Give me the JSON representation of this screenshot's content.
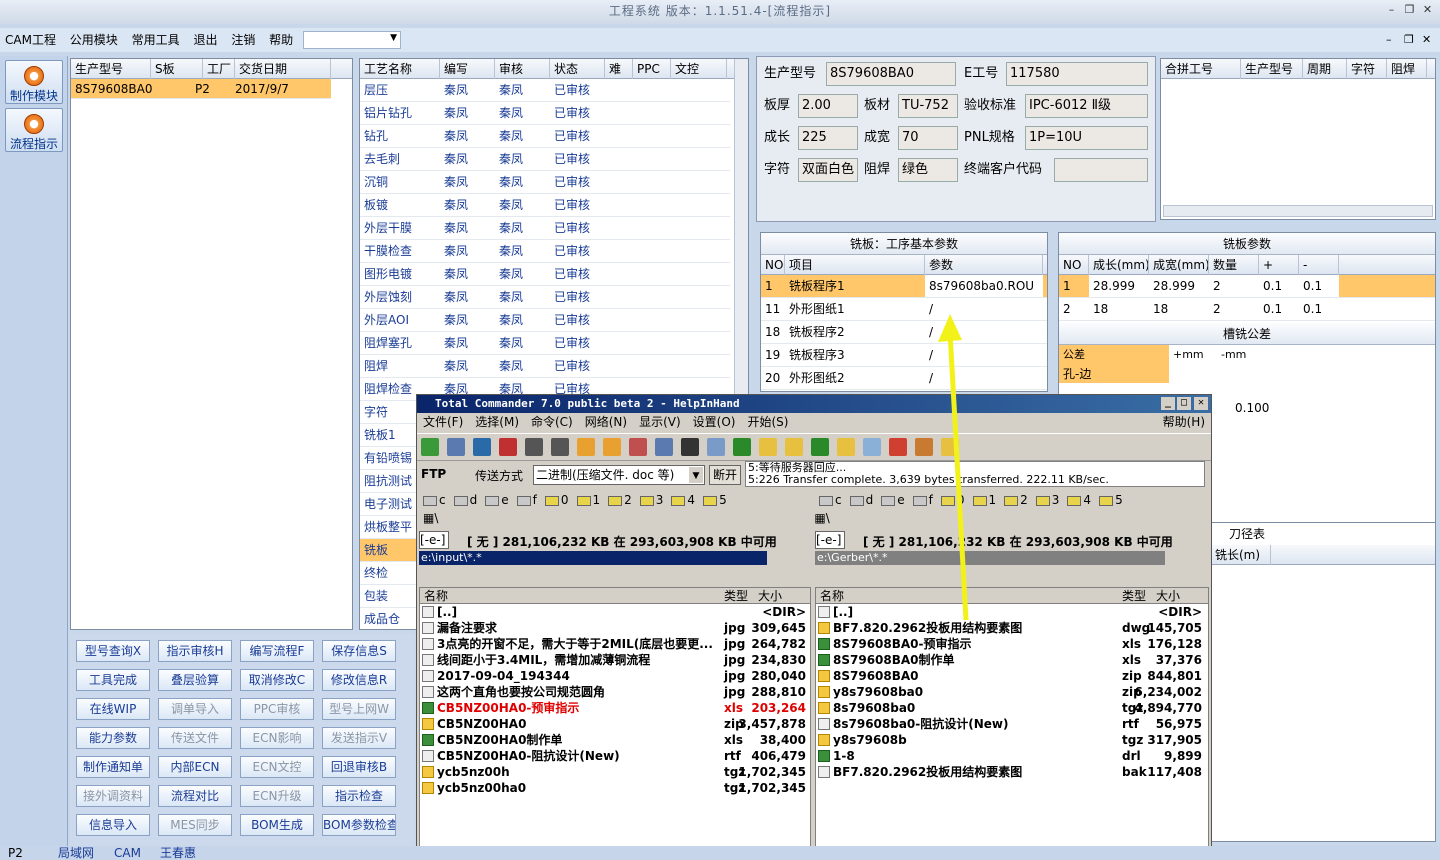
{
  "app": {
    "title": "工程系统 版本：1.1.51.4-[流程指示]"
  },
  "menu": [
    "CAM工程",
    "公用模块",
    "常用工具",
    "退出",
    "注销",
    "帮助"
  ],
  "left_buttons": [
    {
      "label": "制作模块"
    },
    {
      "label": "流程指示"
    }
  ],
  "job_grid": {
    "headers": [
      "生产型号",
      "S板",
      "工厂",
      "交货日期"
    ],
    "rows": [
      [
        "8S79608BA0",
        "",
        "P2",
        "2017/9/7"
      ]
    ]
  },
  "process_grid": {
    "headers": [
      "工艺名称",
      "编写",
      "审核",
      "状态",
      "难",
      "PPC",
      "文控"
    ],
    "rows": [
      [
        "层压",
        "秦凤",
        "秦凤",
        "已审核"
      ],
      [
        "铝片钻孔",
        "秦凤",
        "秦凤",
        "已审核"
      ],
      [
        "钻孔",
        "秦凤",
        "秦凤",
        "已审核"
      ],
      [
        "去毛刺",
        "秦凤",
        "秦凤",
        "已审核"
      ],
      [
        "沉铜",
        "秦凤",
        "秦凤",
        "已审核"
      ],
      [
        "板镀",
        "秦凤",
        "秦凤",
        "已审核"
      ],
      [
        "外层干膜",
        "秦凤",
        "秦凤",
        "已审核"
      ],
      [
        "干膜检查",
        "秦凤",
        "秦凤",
        "已审核"
      ],
      [
        "图形电镀",
        "秦凤",
        "秦凤",
        "已审核"
      ],
      [
        "外层蚀刻",
        "秦凤",
        "秦凤",
        "已审核"
      ],
      [
        "外层AOI",
        "秦凤",
        "秦凤",
        "已审核"
      ],
      [
        "阻焊塞孔",
        "秦凤",
        "秦凤",
        "已审核"
      ],
      [
        "阻焊",
        "秦凤",
        "秦凤",
        "已审核"
      ],
      [
        "阻焊检查",
        "秦凤",
        "秦凤",
        "已审核"
      ],
      [
        "字符",
        "",
        "",
        ""
      ],
      [
        "铣板1",
        "",
        "",
        ""
      ],
      [
        "有铅喷锡",
        "",
        "",
        ""
      ],
      [
        "阻抗测试",
        "",
        "",
        ""
      ],
      [
        "电子测试",
        "",
        "",
        ""
      ],
      [
        "烘板整平",
        "",
        "",
        ""
      ],
      [
        "铣板",
        "",
        "",
        ""
      ],
      [
        "终检",
        "",
        "",
        ""
      ],
      [
        "包装",
        "",
        "",
        ""
      ],
      [
        "成品仓",
        "",
        "",
        ""
      ]
    ]
  },
  "action_buttons": [
    [
      "型号查询X",
      "指示审核H",
      "编写流程F",
      "保存信息S",
      ""
    ],
    [
      "工具完成",
      "叠层验算",
      "取消修改C",
      "修改信息R",
      ""
    ],
    [
      "在线WIP",
      "调单导入",
      "PPC审核",
      "型号上网W",
      ""
    ],
    [
      "能力参数",
      "传送文件",
      "ECN影响",
      "发送指示V",
      ""
    ],
    [
      "制作通知单",
      "内部ECN",
      "ECN文控",
      "回退审核B",
      ""
    ],
    [
      "接外调资料",
      "流程对比",
      "ECN升级",
      "指示检查",
      ""
    ],
    [
      "信息导入",
      "MES同步",
      "BOM生成",
      "BOM参数检查",
      ""
    ]
  ],
  "info": {
    "prod_model_label": "生产型号",
    "prod_model": "8S79608BA0",
    "eid_label": "E工号",
    "eid": "117580",
    "thickness_label": "板厚",
    "thickness": "2.00",
    "material_label": "板材",
    "material": "TU-752",
    "std_label": "验收标准",
    "std": "IPC-6012 Ⅱ级",
    "length_label": "成长",
    "length": "225",
    "width_label": "成宽",
    "width": "70",
    "pnl_label": "PNL规格",
    "pnl": "1P=10U",
    "char_label": "字符",
    "char": "双面白色",
    "mask_label": "阻焊",
    "mask": "绿色",
    "cust_label": "终端客户代码",
    "cust": ""
  },
  "merge_grid": {
    "headers": [
      "合拼工号",
      "生产型号",
      "周期",
      "字符",
      "阻焊"
    ]
  },
  "mill_params": {
    "title": "铣板：工序基本参数",
    "headers": [
      "NO",
      "项目",
      "参数"
    ],
    "rows": [
      [
        "1",
        "铣板程序1",
        "8s79608ba0.ROU"
      ],
      [
        "11",
        "外形图纸1",
        "/"
      ],
      [
        "18",
        "铣板程序2",
        "/"
      ],
      [
        "19",
        "铣板程序3",
        "/"
      ],
      [
        "20",
        "外形图纸2",
        "/"
      ]
    ]
  },
  "board_params": {
    "title": "铣板参数",
    "headers": [
      "NO",
      "成长(mm)",
      "成宽(mm)",
      "数量",
      "+",
      "-"
    ],
    "rows": [
      [
        "1",
        "28.999",
        "28.999",
        "2",
        "0.1",
        "0.1"
      ],
      [
        "2",
        "18",
        "18",
        "2",
        "0.1",
        "0.1"
      ]
    ]
  },
  "tolerance": {
    "title": "槽铣公差",
    "headers": [
      "公差",
      "+mm",
      "-mm"
    ],
    "row_label": "孔-边",
    "value": "0.100"
  },
  "tool_table": {
    "title": "刀径表",
    "header": "铣长(m)"
  },
  "tc": {
    "title": "Total Commander 7.0 public beta 2 - HelpInHand",
    "menu": [
      "文件(F)",
      "选择(M)",
      "命令(C)",
      "网络(N)",
      "显示(V)",
      "设置(O)",
      "开始(S)"
    ],
    "help": "帮助(H)",
    "ftp_label": "FTP",
    "transfer_label": "传送方式",
    "transfer_mode": "二进制(压缩文件. doc 等)",
    "disconnect": "断开",
    "log": [
      "5:等待服务器回应...",
      "5:226 Transfer complete. 3,639 bytes transferred. 222.11 KB/sec."
    ],
    "drives": [
      "c",
      "d",
      "e",
      "f",
      "0",
      "1",
      "2",
      "3",
      "4",
      "5"
    ],
    "drive_sel": "[-e-]",
    "free": "[ 无 ]  281,106,232 KB 在 293,603,908 KB 中可用",
    "left_path": "e:\\input\\*.*",
    "right_path": "e:\\Gerber\\*.*",
    "col_name": "名称",
    "col_type": "类型",
    "col_size": "大小",
    "left_files": [
      [
        "[..]",
        "",
        "<DIR>",
        "d"
      ],
      [
        "漏备注要求",
        "jpg",
        "309,645",
        "d"
      ],
      [
        "3点亮的开窗不足，需大于等于2MIL(底层也要更...",
        "jpg",
        "264,782",
        "d"
      ],
      [
        "线间距小于3.4MIL，需增加减薄铜流程",
        "jpg",
        "234,830",
        "d"
      ],
      [
        "2017-09-04_194344",
        "jpg",
        "280,040",
        "d"
      ],
      [
        "这两个直角也要按公司规范圆角",
        "jpg",
        "288,810",
        "d"
      ],
      [
        "CB5NZ00HA0-预审指示",
        "xls",
        "203,264",
        "x"
      ],
      [
        "CB5NZ00HA0",
        "zip",
        "3,457,878",
        "z"
      ],
      [
        "CB5NZ00HA0制作单",
        "xls",
        "38,400",
        "x"
      ],
      [
        "CB5NZ00HA0-阻抗设计(New)",
        "rtf",
        "406,479",
        "d"
      ],
      [
        "ycb5nz00h",
        "tgz",
        "1,702,345",
        "z"
      ],
      [
        "ycb5nz00ha0",
        "tgz",
        "1,702,345",
        "z"
      ]
    ],
    "right_files": [
      [
        "[..]",
        "",
        "<DIR>",
        "d"
      ],
      [
        "BF7.820.2962投板用结构要素图",
        "dwg",
        "145,705",
        "z"
      ],
      [
        "8S79608BA0-预审指示",
        "xls",
        "176,128",
        "x"
      ],
      [
        "8S79608BA0制作单",
        "xls",
        "37,376",
        "x"
      ],
      [
        "8S79608BA0",
        "zip",
        "844,801",
        "z"
      ],
      [
        "y8s79608ba0",
        "zip",
        "6,234,002",
        "z"
      ],
      [
        "8s79608ba0",
        "tgz",
        "4,894,770",
        "z"
      ],
      [
        "8s79608ba0-阻抗设计(New)",
        "rtf",
        "56,975",
        "d"
      ],
      [
        "y8s79608b",
        "tgz",
        "317,905",
        "z"
      ],
      [
        "1-8",
        "drl",
        "9,899",
        "x"
      ],
      [
        "BF7.820.2962投板用结构要素图",
        "bak",
        "117,408",
        "d"
      ]
    ]
  },
  "statusbar": [
    "P2",
    "局域网",
    "CAM",
    "王春惠"
  ]
}
